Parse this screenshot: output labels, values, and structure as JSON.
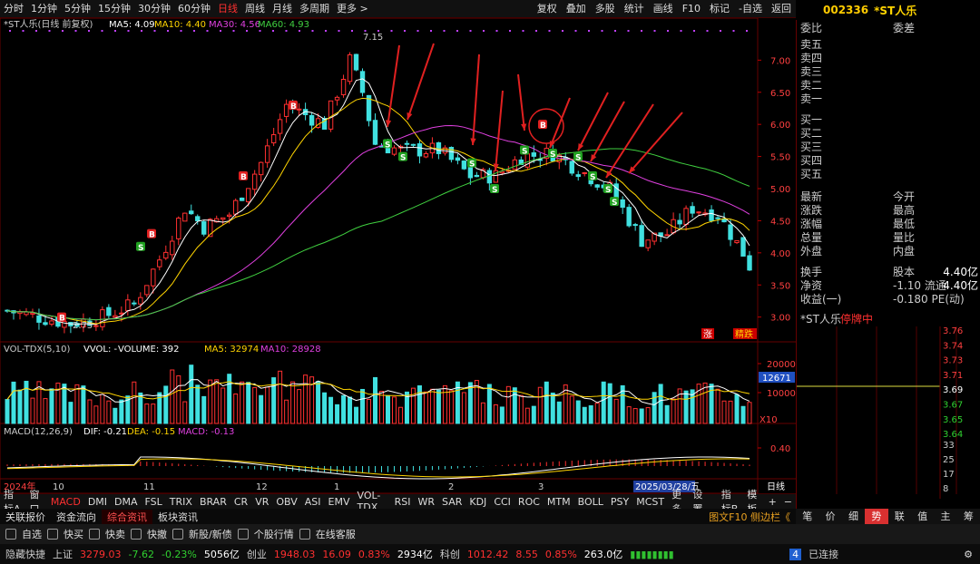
{
  "topbar": {
    "timeframes": [
      "分时",
      "1分钟",
      "5分钟",
      "15分钟",
      "30分钟",
      "60分钟",
      "日线",
      "周线",
      "月线",
      "多周期",
      "更多 >"
    ],
    "active": "日线",
    "tools": [
      "复权",
      "叠加",
      "多股",
      "统计",
      "画线",
      "F10",
      "标记",
      "-自选",
      "返回"
    ]
  },
  "stock": {
    "code": "002336",
    "name": "*ST人乐"
  },
  "main_legend": {
    "title": "*ST人乐(日线 前复权)",
    "ma5": "MA5: 4.09",
    "ma10": "MA10: 4.40",
    "ma30": "MA30: 4.56",
    "ma60": "MA60: 4.93"
  },
  "vol_legend": {
    "title": "VOL-TDX(5,10)",
    "vol": "VVOL: -",
    "volume": "VOLUME: 392",
    "ma5": "MA5: 32974",
    "ma10": "MA10: 28928"
  },
  "macd_legend": {
    "title": "MACD(12,26,9)",
    "dif": "DIF: -0.21",
    "dea": "DEA: -0.15",
    "macd": "MACD: -0.13"
  },
  "annotations": {
    "high": "7.15",
    "low": "2.75",
    "cursor_vol": "12671",
    "x10": "X10",
    "zhang": "涨",
    "jingdie": "精跌",
    "date_box": "2025/03/28/五",
    "rix": "日线"
  },
  "chart_data": {
    "type": "candlestick",
    "price_axis": [
      "7.00",
      "6.50",
      "6.00",
      "5.50",
      "5.00",
      "4.50",
      "4.00",
      "3.50",
      "3.00"
    ],
    "ylim": [
      2.6,
      7.4
    ],
    "vol_axis": [
      "20000",
      "10000"
    ],
    "macd_axis": [
      "0.40"
    ],
    "x_labels": [
      "2024年",
      "10",
      "11",
      "12",
      "1",
      "2",
      "3",
      "2025/03/28/五"
    ]
  },
  "side": {
    "weibi": "委比",
    "weicha": "委差",
    "sell": [
      "卖五",
      "卖四",
      "卖三",
      "卖二",
      "卖一"
    ],
    "buy": [
      "买一",
      "买二",
      "买三",
      "买四",
      "买五"
    ],
    "stats": [
      [
        "最新",
        "今开"
      ],
      [
        "涨跌",
        "最高"
      ],
      [
        "涨幅",
        "最低"
      ],
      [
        "总量",
        "量比"
      ],
      [
        "外盘",
        "内盘"
      ]
    ],
    "fin": [
      {
        "l": "换手",
        "m": "股本",
        "v": "4.40亿"
      },
      {
        "l": "净资",
        "m": "-1.10 流通",
        "v": "4.40亿"
      },
      {
        "l": "收益(一)",
        "m": "-0.180 PE(动)",
        "v": ""
      }
    ],
    "subtitle": "*ST人乐",
    "halt": "停牌中",
    "ticks": [
      "3.76",
      "3.74",
      "3.73",
      "3.71",
      "3.69",
      "3.67",
      "3.65",
      "3.64",
      "33",
      "25",
      "17",
      "8"
    ]
  },
  "ind_tabs": [
    "指标A",
    "窗口",
    "MACD",
    "DMI",
    "DMA",
    "FSL",
    "TRIX",
    "BRAR",
    "CR",
    "VR",
    "OBV",
    "ASI",
    "EMV",
    "VOL-TDX",
    "RSI",
    "WR",
    "SAR",
    "KDJ",
    "CCI",
    "ROC",
    "MTM",
    "BOLL",
    "PSY",
    "MCST",
    "更多",
    "设置"
  ],
  "ind_right": [
    "指标B",
    "模板",
    "+",
    "−"
  ],
  "nav": [
    "关联报价",
    "资金流向",
    "综合资讯",
    "板块资讯"
  ],
  "nav_active": "综合资讯",
  "nav_right": "图文F10 侧边栏《",
  "rtabs": [
    "笔",
    "价",
    "细",
    "势",
    "联",
    "值",
    "主",
    "筹"
  ],
  "rtab_active": "势",
  "bottom1": [
    "自选",
    "快买",
    "快卖",
    "快撤",
    "新股/新债",
    "个股行情",
    "在线客服"
  ],
  "bottom2": {
    "label": "隐藏快捷",
    "sh": "上证",
    "sh_v": "3279.03",
    "sh_c": "-7.62",
    "sh_p": "-0.23%",
    "sh_amt": "5056亿",
    "cy": "创业",
    "cy_v": "1948.03",
    "cy_c": "16.09",
    "cy_p": "0.83%",
    "cy_amt": "2934亿",
    "kc": "科创",
    "kc_v": "1012.42",
    "kc_c": "8.55",
    "kc_p": "0.85%",
    "kc_amt": "263.0亿",
    "conn": "已连接",
    "conn_n": "4"
  }
}
